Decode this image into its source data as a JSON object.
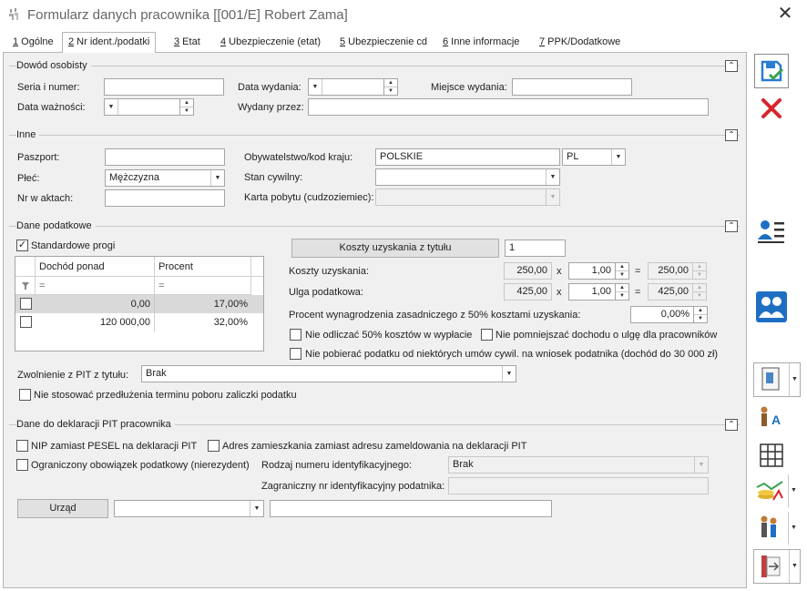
{
  "window": {
    "title": "Formularz danych pracownika [[001/E] Robert Zama]"
  },
  "tabs": [
    {
      "num": "1",
      "label": " Ogólne"
    },
    {
      "num": "2",
      "label": " Nr ident./podatki"
    },
    {
      "num": "3",
      "label": " Etat"
    },
    {
      "num": "4",
      "label": " Ubezpieczenie (etat)"
    },
    {
      "num": "5",
      "label": " Ubezpieczenie cd"
    },
    {
      "num": "6",
      "label": " Inne informacje"
    },
    {
      "num": "7",
      "label": " PPK/Dodatkowe"
    }
  ],
  "dowod": {
    "title": "Dowód osobisty",
    "seria_label": "Seria i numer:",
    "seria_value": "",
    "data_wydania_label": "Data wydania:",
    "miejsce_label": "Miejsce wydania:",
    "miejsce_value": "",
    "data_waznosci_label": "Data ważności:",
    "wydany_label": "Wydany przez:",
    "wydany_value": ""
  },
  "inne": {
    "title": "Inne",
    "paszport_label": "Paszport:",
    "paszport_value": "",
    "plec_label": "Płeć:",
    "plec_value": "Mężczyzna",
    "nr_akt_label": "Nr w aktach:",
    "nr_akt_value": "",
    "obyw_label": "Obywatelstwo/kod kraju:",
    "obyw_value": "POLSKIE",
    "kraj_value": "PL",
    "stan_label": "Stan cywilny:",
    "stan_value": "",
    "karta_label": "Karta pobytu (cudzoziemiec):",
    "karta_value": ""
  },
  "podatkowe": {
    "title": "Dane podatkowe",
    "standardowe_label": "Standardowe progi",
    "grid_headers": [
      "Dochód ponad",
      "Procent"
    ],
    "filter_symbol": "=",
    "rows": [
      {
        "dochod": "0,00",
        "procent": "17,00%"
      },
      {
        "dochod": "120 000,00",
        "procent": "32,00%"
      }
    ],
    "koszty_tytulu_button": "Koszty uzyskania z tytułu",
    "koszty_tytulu_value": "1",
    "koszty_label": "Koszty uzyskania:",
    "koszty_base": "250,00",
    "koszty_mult": "1,00",
    "koszty_result": "250,00",
    "ulga_label": "Ulga podatkowa:",
    "ulga_base": "425,00",
    "ulga_mult": "1,00",
    "ulga_result": "425,00",
    "times": "x",
    "equals": "=",
    "procent_label": "Procent wynagrodzenia zasadniczego z 50% kosztami uzyskania:",
    "procent_value": "0,00%",
    "nie_odliczac": "Nie odliczać 50% kosztów w wypłacie",
    "nie_pomniejszac": "Nie pomniejszać dochodu o ulgę dla pracowników",
    "nie_pobierac": "Nie pobierać podatku od niektórych umów cywil. na wniosek podatnika (dochód do 30 000 zł)",
    "zwolnienie_label": "Zwolnienie z PIT z tytułu:",
    "zwolnienie_value": "Brak",
    "nie_stosowac": "Nie stosować przedłużenia terminu poboru zaliczki podatku"
  },
  "pit": {
    "title": "Dane do deklaracji PIT pracownika",
    "nip_label": "NIP zamiast PESEL na deklaracji PIT",
    "adres_label": "Adres zamieszkania zamiast adresu zameldowania na deklaracji PIT",
    "ograniczony_label": "Ograniczony obowiązek podatkowy (nierezydent)",
    "rodzaj_label": "Rodzaj numeru identyfikacyjnego:",
    "rodzaj_value": "Brak",
    "zagraniczny_label": "Zagraniczny nr identyfikacyjny podatnika:",
    "zagraniczny_value": "",
    "urzad_button": "Urząd",
    "urzad_value": "",
    "urzad_name": ""
  },
  "colors": {
    "accent": "#1e6fc3",
    "cancel": "#d9232d",
    "save": "#2a7dd1"
  }
}
